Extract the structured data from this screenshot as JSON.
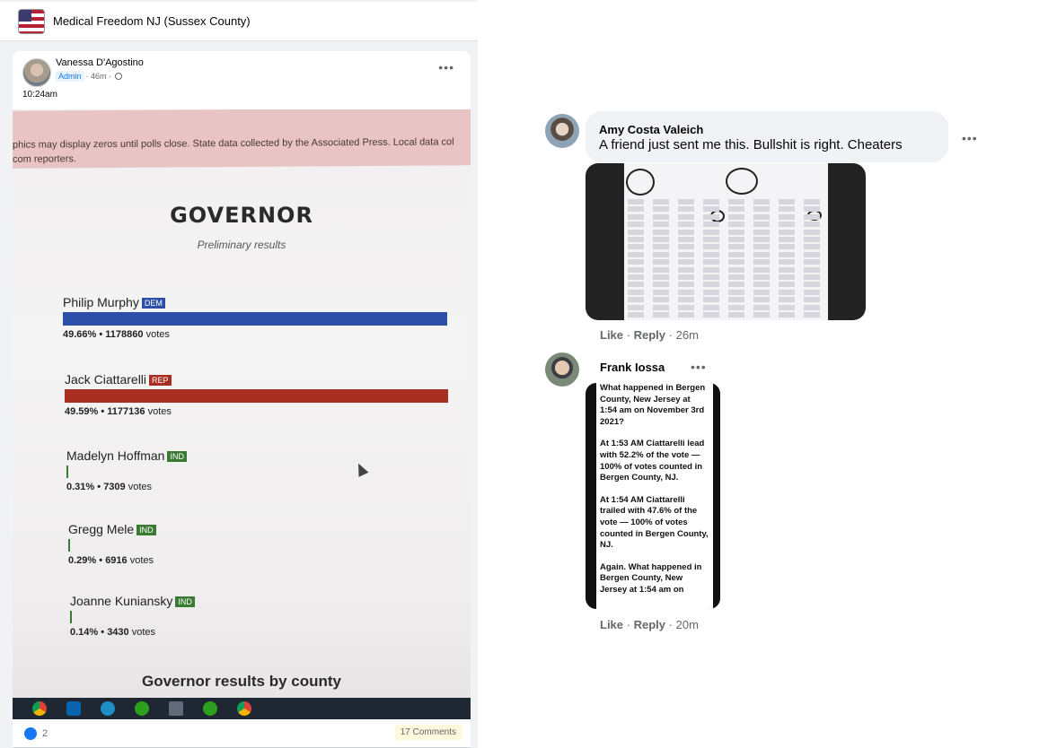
{
  "group": {
    "name": "Medical Freedom NJ (Sussex County)"
  },
  "post": {
    "author": "Vanessa D'Agostino",
    "badge": "Admin",
    "age": "· 46m ·",
    "time": "10:24am",
    "more_label": "•••",
    "likes": "2",
    "comments": "17 Comments"
  },
  "photo": {
    "disclaimer_line1": "phics may display zeros until polls close. State data collected by the Associated Press. Local data col",
    "disclaimer_line2": "com reporters.",
    "title": "GOVERNOR",
    "subtitle": "Preliminary results",
    "candidates": [
      {
        "name": "Philip Murphy",
        "party": "DEM",
        "pct": "49.66%",
        "votes": "1178860",
        "share": 0.4966,
        "color": "#2e4fa8"
      },
      {
        "name": "Jack Ciattarelli",
        "party": "REP",
        "pct": "49.59%",
        "votes": "1177136",
        "share": 0.4959,
        "color": "#a82e22"
      },
      {
        "name": "Madelyn Hoffman",
        "party": "IND",
        "pct": "0.31%",
        "votes": "7309",
        "share": 0.0031,
        "color": "#3b7a33"
      },
      {
        "name": "Gregg Mele",
        "party": "IND",
        "pct": "0.29%",
        "votes": "6916",
        "share": 0.0029,
        "color": "#3b7a33"
      },
      {
        "name": "Joanne Kuniansky",
        "party": "IND",
        "pct": "0.14%",
        "votes": "3430",
        "share": 0.0014,
        "color": "#3b7a33"
      }
    ],
    "votes_word": "votes",
    "separator": "•",
    "county_title": "Governor results by county"
  },
  "comments": [
    {
      "author": "Amy Costa Valeich",
      "text": "A friend just sent me this. Bullshit is right. Cheaters",
      "like": "Like",
      "reply": "Reply",
      "age": "26m"
    },
    {
      "author": "Frank Iossa",
      "image_text": [
        "What happened in Bergen County, New Jersey at 1:54 am on November 3rd 2021?",
        "At 1:53 AM Ciattarelli lead with 52.2% of the vote — 100% of votes counted in Bergen County, NJ.",
        "At 1:54 AM Ciattarelli trailed with 47.6% of the vote — 100% of votes counted in Bergen County, NJ.",
        "Again. What happened in Bergen County, New Jersey at 1:54 am on"
      ],
      "like": "Like",
      "reply": "Reply",
      "age": "20m"
    }
  ],
  "ui": {
    "dots": "•••",
    "dot_sep": "·"
  },
  "colors": {
    "facebook_blue": "#1877f2",
    "secondary_text": "#65676b",
    "bubble_bg": "#f0f2f5"
  }
}
